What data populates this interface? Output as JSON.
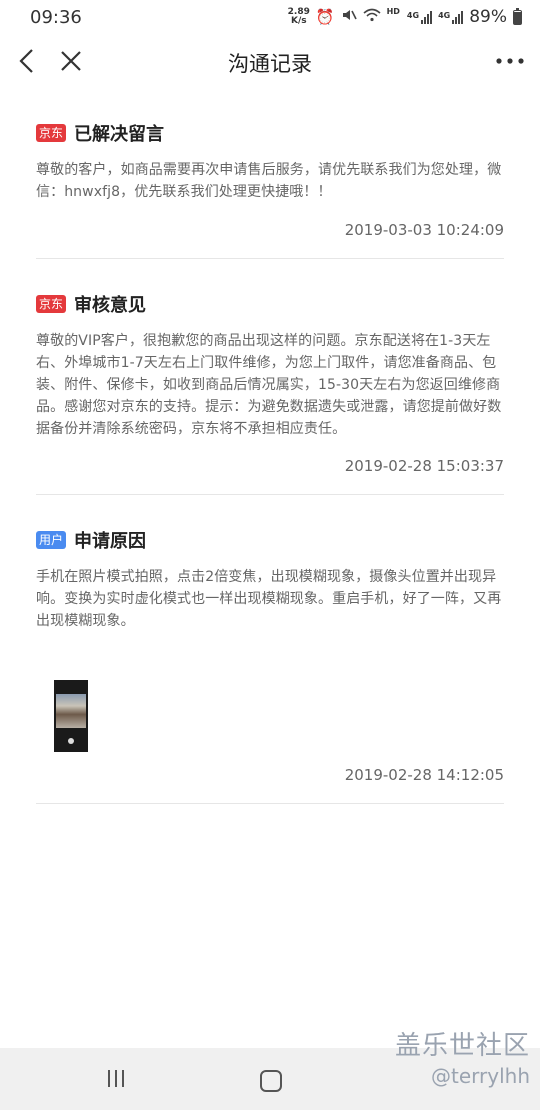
{
  "status_bar": {
    "time": "09:36",
    "net_speed_value": "2.89",
    "net_speed_unit": "K/s",
    "hd_label": "HD",
    "sim1_label": "4G",
    "sim2_label": "4G",
    "battery_text": "89%",
    "battery_level": 0.89,
    "icons": [
      "alarm-icon",
      "mute-icon",
      "wifi-icon",
      "signal-icon",
      "battery-icon"
    ]
  },
  "nav": {
    "title": "沟通记录",
    "icons": [
      "back-icon",
      "close-icon",
      "more-icon"
    ]
  },
  "records": [
    {
      "tag": "京东",
      "title": "已解决留言",
      "text": "尊敬的客户，如商品需要再次申请售后服务，请优先联系我们为您处理，微信：hnwxfj8，优先联系我们处理更快捷哦！！",
      "time": "2019-03-03 10:24:09"
    },
    {
      "tag": "京东",
      "title": "审核意见",
      "text": "尊敬的VIP客户，很抱歉您的商品出现这样的问题。京东配送将在1-3天左右、外埠城市1-7天左右上门取件维修，为您上门取件，请您准备商品、包装、附件、保修卡，如收到商品后情况属实，15-30天左右为您返回维修商品。感谢您对京东的支持。提示：为避免数据遗失或泄露，请您提前做好数据备份并清除系统密码，京东将不承担相应责任。",
      "time": "2019-02-28 15:03:37"
    },
    {
      "tag": "用户",
      "title": "申请原因",
      "text": "手机在照片模式拍照，点击2倍变焦，出现模糊现象，摄像头位置并出现异响。变换为实时虚化模式也一样出现模糊现象。重启手机，好了一阵，又再出现模糊现象。",
      "time": "2019-02-28 14:12:05"
    }
  ],
  "watermark": {
    "site": "盖乐世社区",
    "user": "@terrylhh"
  },
  "colors": {
    "jd_tag": "#e4393c",
    "user_tag": "#4a8bf0"
  }
}
